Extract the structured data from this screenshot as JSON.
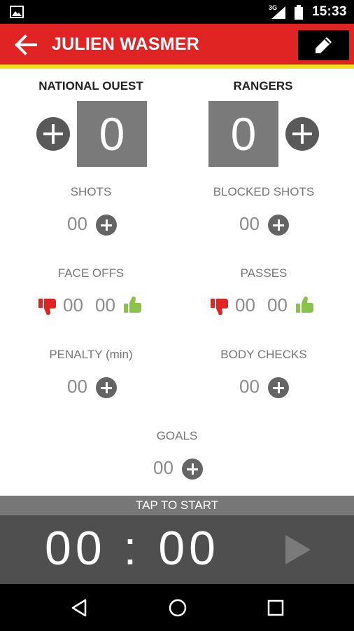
{
  "status_bar": {
    "network": "3G",
    "time": "15:33"
  },
  "app_bar": {
    "title": "JULIEN WASMER",
    "icons": {
      "back": "arrow-left-icon",
      "edit": "pencil-icon"
    }
  },
  "colors": {
    "primary": "#e02424",
    "accent": "#f6de1e",
    "dislike": "#e02424",
    "like": "#8bc34a",
    "score_box": "#7a7a7a"
  },
  "teams": {
    "home": {
      "name": "NATIONAL OUEST",
      "score": "0"
    },
    "away": {
      "name": "RANGERS",
      "score": "0"
    }
  },
  "stats": {
    "shots": {
      "label": "SHOTS",
      "value": "00"
    },
    "blocked_shots": {
      "label": "BLOCKED SHOTS",
      "value": "00"
    },
    "face_offs": {
      "label": "FACE OFFS",
      "lost": "00",
      "won": "00"
    },
    "passes": {
      "label": "PASSES",
      "lost": "00",
      "won": "00"
    },
    "penalty": {
      "label": "PENALTY (min)",
      "value": "00"
    },
    "body_checks": {
      "label": "BODY CHECKS",
      "value": "00"
    },
    "goals": {
      "label": "GOALS",
      "value": "00"
    }
  },
  "timer": {
    "tap_label": "TAP TO START",
    "value": "00 : 00"
  }
}
